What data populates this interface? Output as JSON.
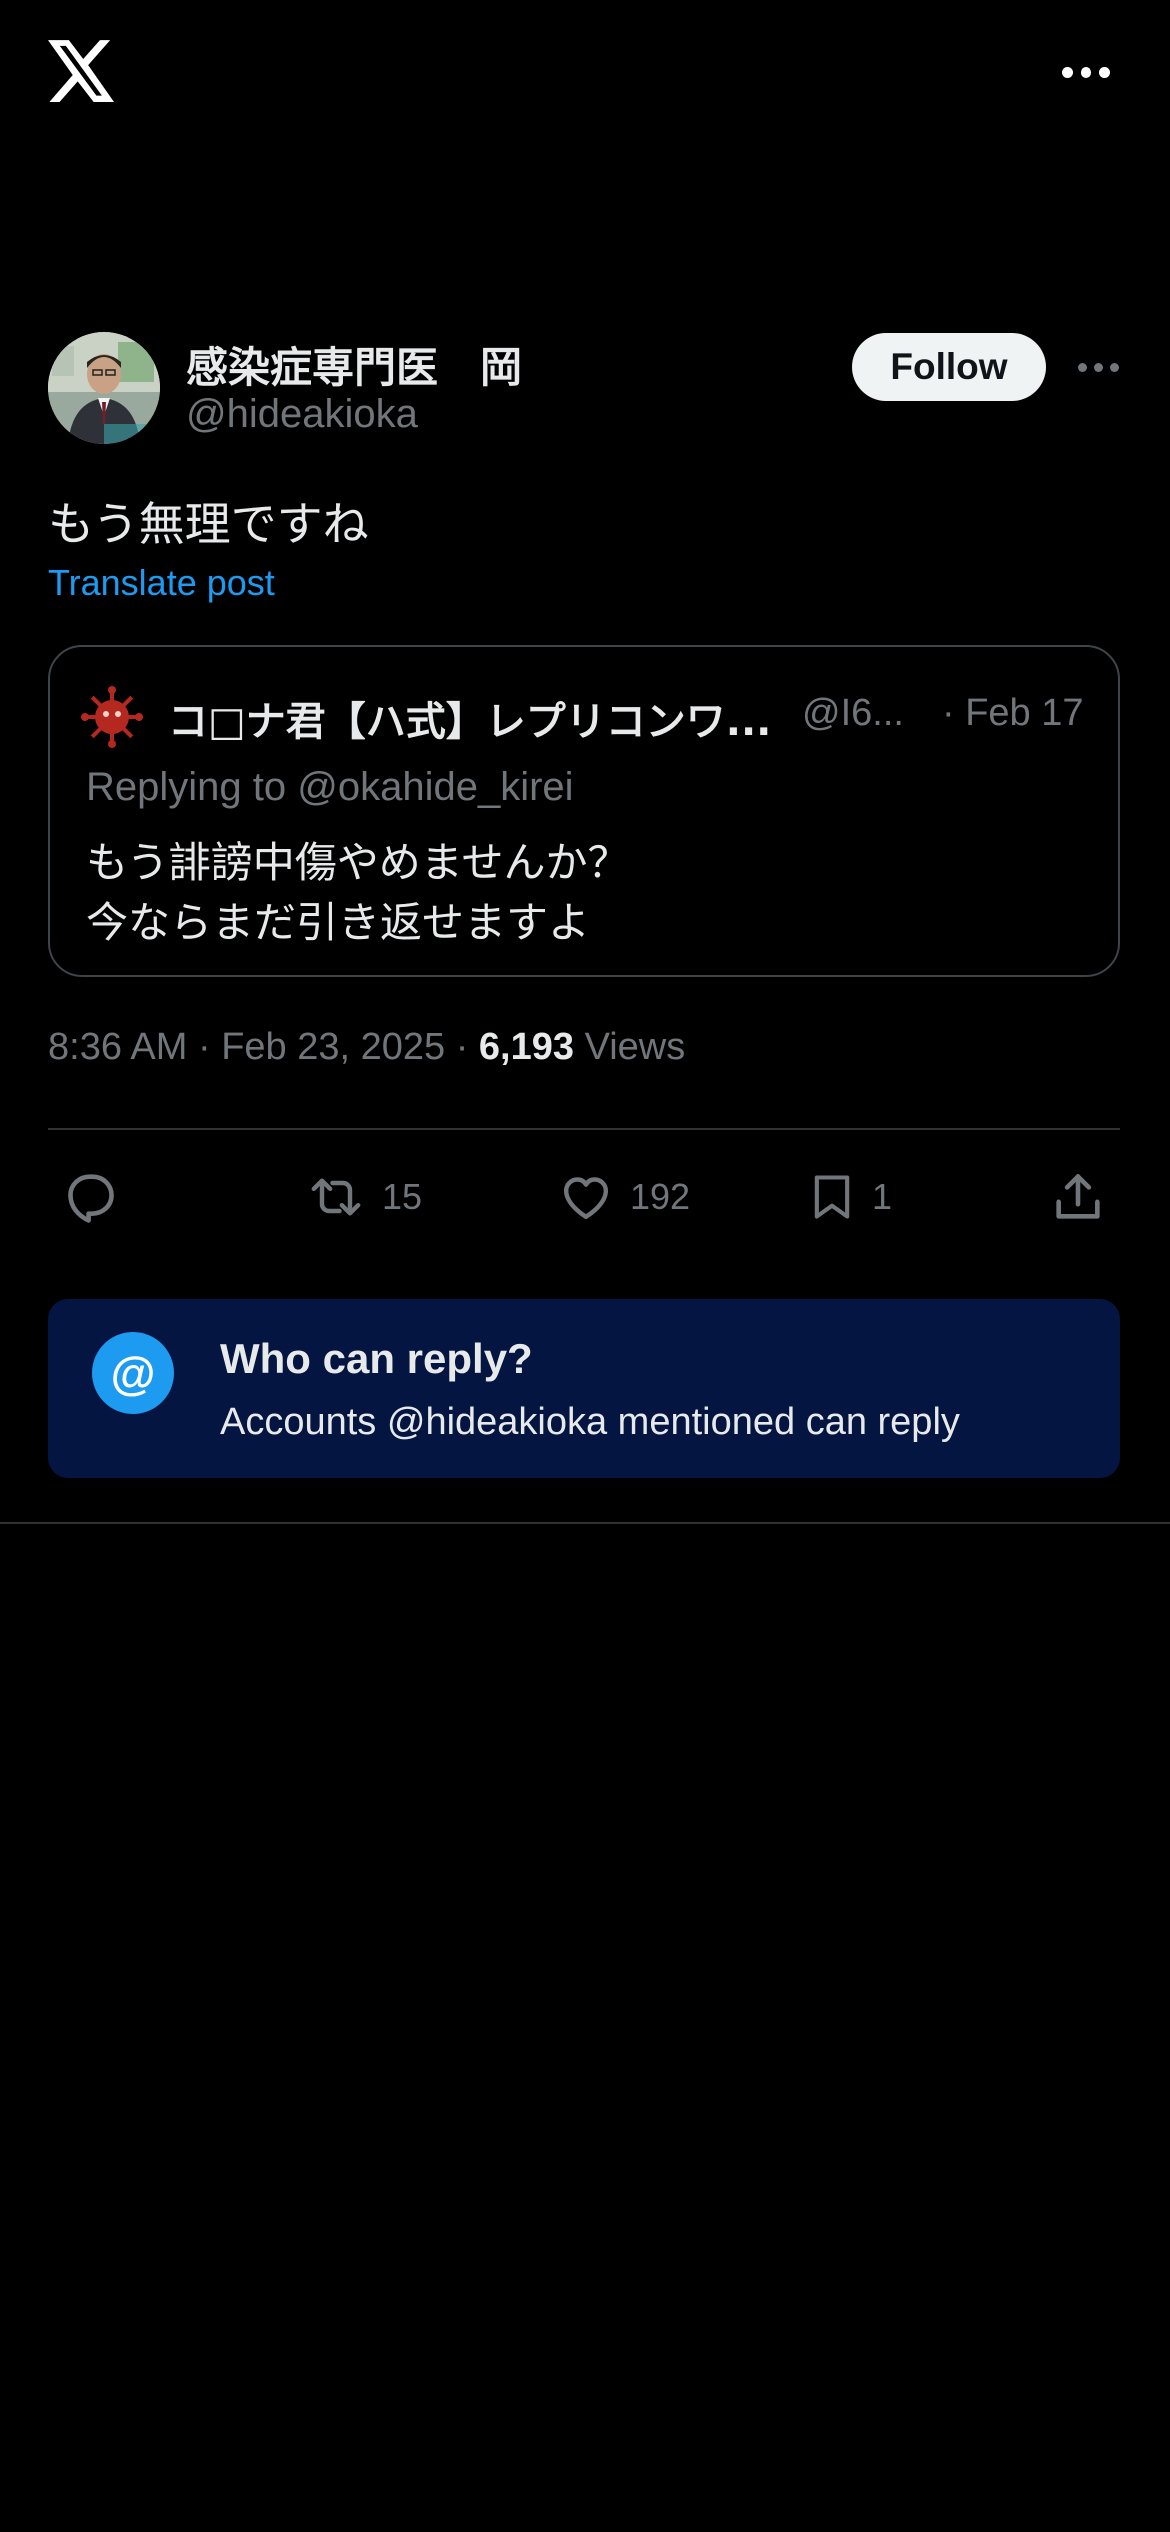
{
  "header": {
    "logo_icon": "x-logo-icon",
    "more_icon": "more-horizontal-icon"
  },
  "post": {
    "author": {
      "name": "感染症専門医　岡",
      "handle": "@hideakioka",
      "avatar": "avatar-photo"
    },
    "follow_label": "Follow",
    "text": "もう無理ですね",
    "translate_label": "Translate post",
    "quote": {
      "author_name": "コ□ナ君【ハ式】レプリコンワ...",
      "author_handle": "@I6...",
      "date": "· Feb 17",
      "replying_to": "Replying to @okahide_kirei",
      "text_line1": "もう誹謗中傷やめませんか？",
      "text_line2": "今ならまだ引き返せますよ"
    },
    "meta": {
      "time_date": "8:36 AM · Feb 23, 2025 · ",
      "views_count": "6,193",
      "views_label": " Views"
    },
    "actions": {
      "reply_icon": "reply-icon",
      "retweet_icon": "retweet-icon",
      "retweet_count": "15",
      "like_icon": "heart-icon",
      "like_count": "192",
      "bookmark_icon": "bookmark-icon",
      "bookmark_count": "1",
      "share_icon": "share-icon"
    },
    "who_can_reply": {
      "icon_glyph": "@",
      "title": "Who can reply?",
      "description": "Accounts @hideakioka mentioned can reply"
    }
  },
  "colors": {
    "background": "#000000",
    "text": "#e7e9ea",
    "muted": "#71767b",
    "accent": "#1d9bf0",
    "reply_box_bg": "#031540",
    "border": "#2f3336"
  }
}
